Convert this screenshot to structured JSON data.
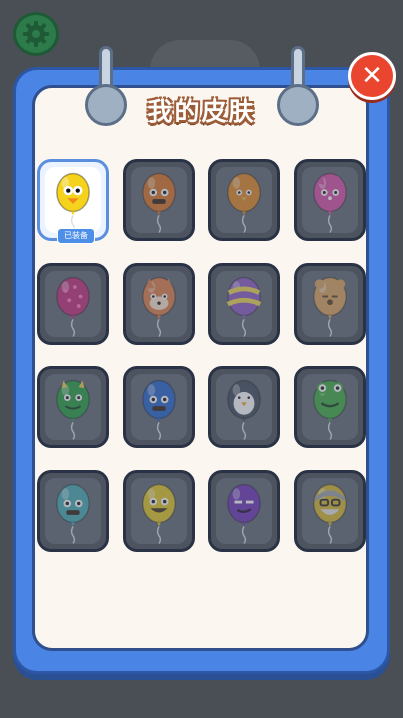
{
  "header": {
    "title": "我的皮肤"
  },
  "skins": [
    {
      "name": "chick",
      "color": "#f5d21c",
      "face": "chick",
      "selected": true,
      "badge": "已装备"
    },
    {
      "name": "orange-monster",
      "color": "#d9701f",
      "face": "monster"
    },
    {
      "name": "orange-bird",
      "color": "#e0851e",
      "face": "bird"
    },
    {
      "name": "pink-cat",
      "color": "#d84aa5",
      "face": "cat"
    },
    {
      "name": "pink-polka",
      "color": "#c2267a",
      "face": "plain"
    },
    {
      "name": "fox",
      "color": "#e07a43",
      "face": "fox"
    },
    {
      "name": "purple-stripes",
      "color": "#8a57c4",
      "face": "stripes"
    },
    {
      "name": "bear",
      "color": "#d9a05a",
      "face": "bear"
    },
    {
      "name": "green-dragon",
      "color": "#1e9a3d",
      "face": "dragon"
    },
    {
      "name": "blue-monster",
      "color": "#1f5fcc",
      "face": "monster"
    },
    {
      "name": "penguin",
      "color": "#3c4558",
      "face": "penguin"
    },
    {
      "name": "frog",
      "color": "#3aa83f",
      "face": "frog"
    },
    {
      "name": "teal-monster",
      "color": "#3fa7b0",
      "face": "monster"
    },
    {
      "name": "yellow-smile",
      "color": "#e3c51e",
      "face": "smile"
    },
    {
      "name": "purple-smirk",
      "color": "#6a2fb8",
      "face": "smirk"
    },
    {
      "name": "old-man",
      "color": "#d8b62a",
      "face": "oldman"
    }
  ]
}
